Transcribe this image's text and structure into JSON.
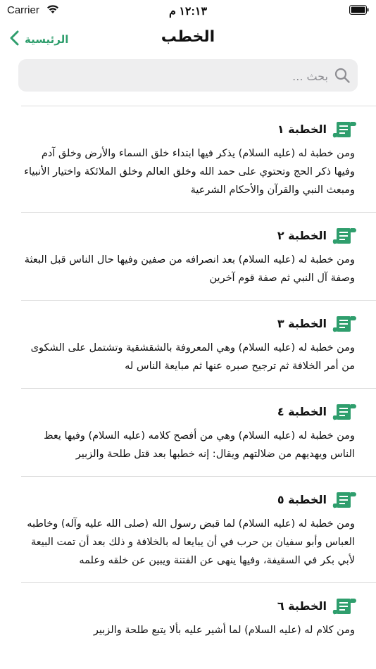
{
  "status_bar": {
    "carrier": "Carrier",
    "time": "١٢:١٣ م",
    "icons": [
      "wifi-icon",
      "battery-icon"
    ]
  },
  "nav": {
    "back_label": "الرئيسية",
    "title": "الخطب"
  },
  "search": {
    "placeholder": "بحث ..."
  },
  "colors": {
    "accent": "#2f9e6d",
    "separator": "#dcdcdc",
    "search_bg": "#eeeeef"
  },
  "sermons": [
    {
      "title": "الخطبة ١",
      "description": "ومن خطبة له (عليه السلام) يذكر فيها ابتداء خلق السماء والأرض وخلق آدم وفيها ذكر الحج وتحتوي على حمد الله وخلق العالم وخلق الملائكة واختيار الأنبياء ومبعث النبي والقرآن والأحكام الشرعية"
    },
    {
      "title": "الخطبة ٢",
      "description": "ومن خطبة له (عليه السلام) بعد انصرافه من صفين وفيها حال الناس قبل البعثة وصفة آل النبي ثم صفة قوم آخرين"
    },
    {
      "title": "الخطبة ٣",
      "description": " ومن خطبة له (عليه السلام) وهي المعروفة بالشقشقية وتشتمل على الشكوى من أمر الخلافة ثم ترجيح صبره عنها ثم مبايعة الناس له"
    },
    {
      "title": "الخطبة ٤",
      "description": "ومن خطبة له (عليه السلام) وهي من أفصح كلامه (عليه السلام) وفيها يعظ الناس ويهديهم من ضلالتهم ويقال: إنه خطبها بعد قتل طلحة والزبير"
    },
    {
      "title": "الخطبة ٥",
      "description": "ومن خطبة له (عليه السلام) لما قبض رسول الله (صلى الله عليه وآله) وخاطبه العباس وأبو سفيان بن حرب في أن يبايعا له بالخلافة و ذلك بعد أن تمت البيعة لأبي بكر في السقيفة، وفيها ينهى عن الفتنة ويبين عن خلقه وعلمه"
    },
    {
      "title": "الخطبة ٦",
      "description": "ومن كلام له (عليه السلام) لما أشير عليه بألا يتبع طلحة والزبير"
    }
  ]
}
